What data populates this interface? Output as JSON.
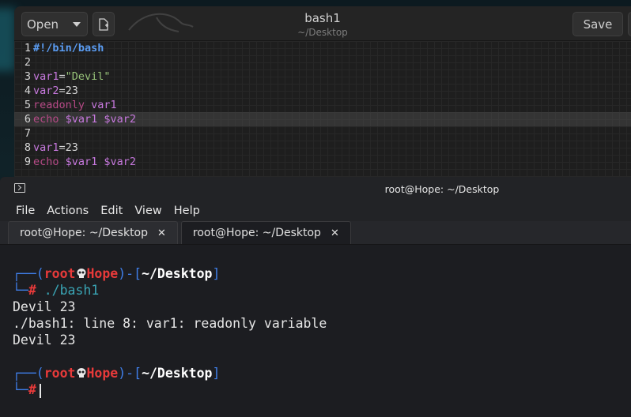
{
  "editor": {
    "title": "bash1",
    "subtitle": "~/Desktop",
    "open_label": "Open",
    "save_label": "Save",
    "lines": [
      {
        "num": "1",
        "segments": [
          {
            "text": "#!/bin/bash",
            "cls": "t-shebang"
          }
        ]
      },
      {
        "num": "2",
        "segments": []
      },
      {
        "num": "3",
        "segments": [
          {
            "text": "var1",
            "cls": "t-var"
          },
          {
            "text": "=",
            "cls": "t-plain"
          },
          {
            "text": "\"Devil\"",
            "cls": "t-str"
          }
        ]
      },
      {
        "num": "4",
        "segments": [
          {
            "text": "var2",
            "cls": "t-var"
          },
          {
            "text": "=23",
            "cls": "t-plain"
          }
        ]
      },
      {
        "num": "5",
        "segments": [
          {
            "text": "readonly ",
            "cls": "t-kw"
          },
          {
            "text": "var1",
            "cls": "t-var"
          }
        ]
      },
      {
        "num": "6",
        "current": true,
        "segments": [
          {
            "text": "echo ",
            "cls": "t-kw"
          },
          {
            "text": "$var1 $var2",
            "cls": "t-dollar"
          }
        ]
      },
      {
        "num": "7",
        "segments": []
      },
      {
        "num": "8",
        "segments": [
          {
            "text": "var1",
            "cls": "t-var"
          },
          {
            "text": "=23",
            "cls": "t-plain"
          }
        ]
      },
      {
        "num": "9",
        "segments": [
          {
            "text": "echo ",
            "cls": "t-kw"
          },
          {
            "text": "$var1 $var2",
            "cls": "t-dollar"
          }
        ]
      }
    ]
  },
  "terminal": {
    "title": "root@Hope: ~/Desktop",
    "menu": [
      "File",
      "Actions",
      "Edit",
      "View",
      "Help"
    ],
    "tabs": [
      {
        "label": "root@Hope: ~/Desktop",
        "active": false
      },
      {
        "label": "root@Hope: ~/Desktop",
        "active": true
      }
    ],
    "prompt": {
      "user": "root",
      "host": "Hope",
      "path": "~/Desktop",
      "symbol": "#"
    },
    "command": "./bash1",
    "output": [
      "Devil 23",
      "./bash1: line 8: var1: readonly variable",
      "Devil 23"
    ]
  },
  "colors": {
    "prompt_frame": "#3f7ee8",
    "prompt_user": "#e83a3a",
    "command": "#3aa5b5"
  }
}
